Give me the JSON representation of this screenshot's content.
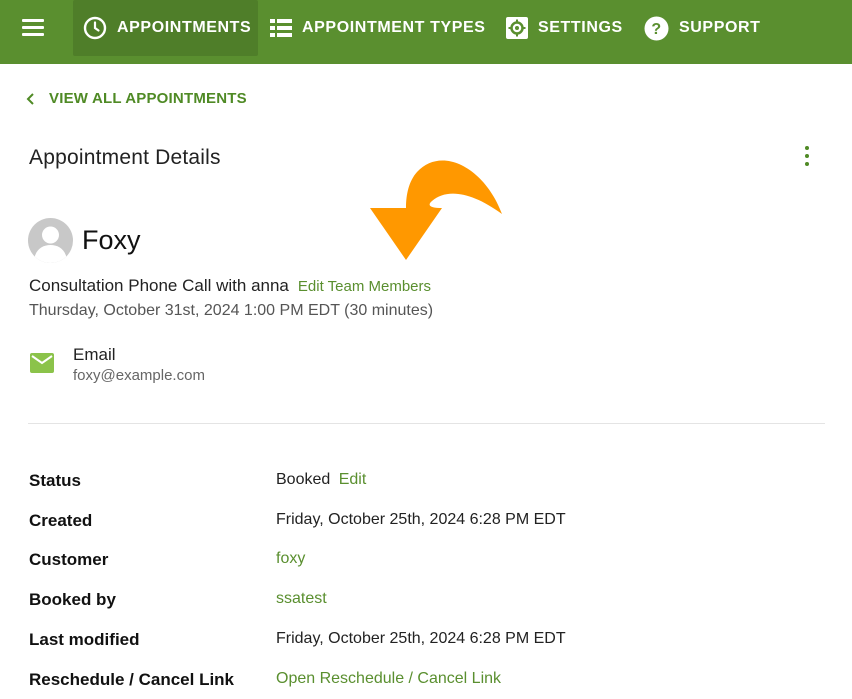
{
  "nav": {
    "menu_icon": "hamburger-menu-icon",
    "items": [
      {
        "label": "APPOINTMENTS",
        "icon": "clock-icon",
        "active": true
      },
      {
        "label": "APPOINTMENT TYPES",
        "icon": "list-icon",
        "active": false
      },
      {
        "label": "SETTINGS",
        "icon": "gear-icon",
        "active": false
      },
      {
        "label": "SUPPORT",
        "icon": "question-circle-icon",
        "active": false
      }
    ]
  },
  "back_link": {
    "label": "VIEW ALL APPOINTMENTS",
    "icon": "chevron-left-icon"
  },
  "page": {
    "title": "Appointment Details",
    "menu_icon": "more-vertical-icon"
  },
  "annotation": {
    "icon": "curved-arrow-icon",
    "color": "#ff9800"
  },
  "customer": {
    "name": "Foxy",
    "avatar_icon": "person-avatar-icon",
    "appointment_title": "Consultation Phone Call with anna",
    "edit_team_label": "Edit Team Members",
    "datetime": "Thursday, October 31st, 2024 1:00 PM EDT (30 minutes)",
    "email_label": "Email",
    "email_value": "foxy@example.com",
    "email_icon": "envelope-icon"
  },
  "details": {
    "status": {
      "label": "Status",
      "value": "Booked",
      "action": "Edit"
    },
    "created": {
      "label": "Created",
      "value": "Friday, October 25th, 2024 6:28 PM EDT"
    },
    "customer": {
      "label": "Customer",
      "value": "foxy"
    },
    "booked_by": {
      "label": "Booked by",
      "value": "ssatest"
    },
    "last_modified": {
      "label": "Last modified",
      "value": "Friday, October 25th, 2024 6:28 PM EDT"
    },
    "reschedule": {
      "label": "Reschedule / Cancel Link",
      "value": "Open Reschedule / Cancel Link"
    }
  },
  "colors": {
    "brand": "#5a8f2f",
    "brand_dark": "#4f7e29",
    "accent_green": "#8bc34a"
  }
}
